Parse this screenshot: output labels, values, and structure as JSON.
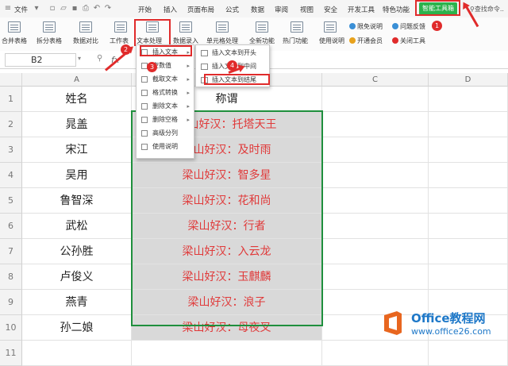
{
  "menubar": {
    "file": "文件",
    "tabs": [
      "开始",
      "插入",
      "页面布局",
      "公式",
      "数据",
      "审阅",
      "视图",
      "安全",
      "开发工具",
      "特色功能"
    ],
    "smart_tab": "智能工具箱",
    "search": "查找命令"
  },
  "ribbon": {
    "buttons": [
      "合并表格",
      "拆分表格",
      "数据对比",
      "工作表",
      "文本处理",
      "数据录入",
      "单元格处理",
      "全新功能",
      "热门功能",
      "使用说明"
    ],
    "small": [
      "限免说明",
      "开通会员",
      "问题反馈",
      "关闭工具"
    ]
  },
  "formula_bar": {
    "cell_ref": "B2",
    "fx": "fx"
  },
  "columns": [
    "A",
    "B",
    "C",
    "D"
  ],
  "rows": [
    {
      "num": "1",
      "a": "姓名",
      "b": "称谓"
    },
    {
      "num": "2",
      "a": "晁盖",
      "b": "梁山好汉：托塔天王"
    },
    {
      "num": "3",
      "a": "宋江",
      "b": "梁山好汉：及时雨"
    },
    {
      "num": "4",
      "a": "吴用",
      "b": "梁山好汉：智多星"
    },
    {
      "num": "5",
      "a": "鲁智深",
      "b": "梁山好汉：花和尚"
    },
    {
      "num": "6",
      "a": "武松",
      "b": "梁山好汉：行者"
    },
    {
      "num": "7",
      "a": "公孙胜",
      "b": "梁山好汉：入云龙"
    },
    {
      "num": "8",
      "a": "卢俊义",
      "b": "梁山好汉：玉麒麟"
    },
    {
      "num": "9",
      "a": "燕青",
      "b": "梁山好汉：浪子"
    },
    {
      "num": "10",
      "a": "孙二娘",
      "b": "梁山好汉：母夜叉"
    },
    {
      "num": "11",
      "a": "",
      "b": ""
    }
  ],
  "dropdown": [
    "插入文本",
    "空数值",
    "截取文本",
    "格式转换",
    "删除文本",
    "删除空格",
    "高级分列",
    "使用说明"
  ],
  "submenu": [
    "插入文本到开头",
    "插入文本到中间",
    "插入文本到结尾"
  ],
  "badges": [
    "1",
    "2",
    "3",
    "4"
  ],
  "watermark": {
    "title": "Office教程网",
    "url": "www.office26.com"
  },
  "colors": {
    "accent_green": "#2bb24c",
    "annotation_red": "#e02b2b",
    "selection_green": "#1f8f3d",
    "text_red": "#e03a3a"
  }
}
